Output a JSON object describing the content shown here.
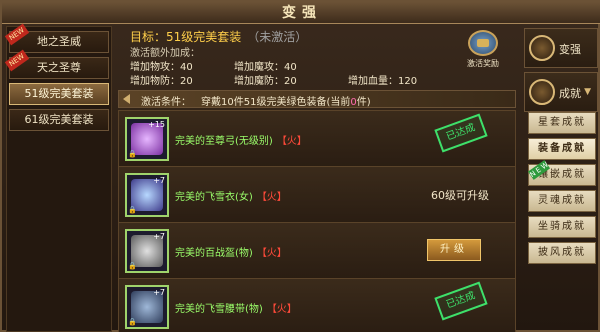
{
  "window": {
    "title": "变强"
  },
  "left_tabs": [
    {
      "label": "地之圣威",
      "ribbon": "NEW"
    },
    {
      "label": "天之圣尊",
      "ribbon": "NEW"
    },
    {
      "label": "51级完美套装",
      "ribbon": ""
    },
    {
      "label": "61级完美套装",
      "ribbon": ""
    }
  ],
  "header": {
    "target": "目标：51级完美套装",
    "status": "（未激活）",
    "bonus_title": "激活额外加成：",
    "stats": [
      "增加物攻：40",
      "增加魔攻：40",
      "增加物防：20",
      "增加魔防：20",
      "增加血量：120"
    ],
    "reward_label": "激活奖励"
  },
  "condition": {
    "label": "激活条件：",
    "text_prefix": "穿戴10件51级完美绿色装备(当前",
    "current": "0",
    "text_suffix": "件)"
  },
  "items": [
    {
      "name": "完美的至尊弓(无级别)",
      "tag": "【火】",
      "plus": "+15",
      "stamp": "已达成",
      "note": "",
      "button": ""
    },
    {
      "name": "完美的飞雪衣(女)",
      "tag": "【火】",
      "plus": "+7",
      "stamp": "",
      "note": "60级可升级",
      "button": ""
    },
    {
      "name": "完美的百战盔(物)",
      "tag": "【火】",
      "plus": "+7",
      "stamp": "",
      "note": "",
      "button": "升级"
    },
    {
      "name": "完美的飞雪腰带(物)",
      "tag": "【火】",
      "plus": "+7",
      "stamp": "已达成",
      "note": "",
      "button": ""
    }
  ],
  "right_panel": {
    "top_buttons": [
      "变强",
      "成就"
    ],
    "menu": [
      {
        "label": "星套成就",
        "ribbon": ""
      },
      {
        "label": "装备成就",
        "ribbon": ""
      },
      {
        "label": "镶嵌成就",
        "ribbon": "NEW"
      },
      {
        "label": "灵魂成就",
        "ribbon": ""
      },
      {
        "label": "坐骑成就",
        "ribbon": ""
      },
      {
        "label": "披风成就",
        "ribbon": ""
      }
    ]
  },
  "colors": {
    "accent_gold": "#ffcf4a",
    "item_green": "#9bff6b",
    "tag_red": "#ff4a3a",
    "stamp_green": "#3ee06a",
    "count_pink": "#ff6bb0"
  }
}
